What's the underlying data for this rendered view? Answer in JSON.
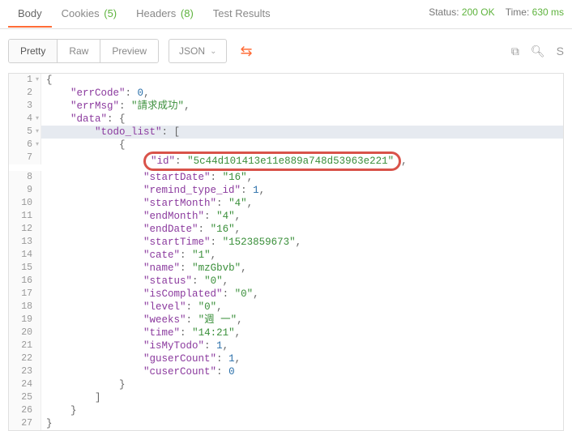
{
  "tabs": {
    "body": "Body",
    "cookies": "Cookies",
    "cookies_count": "(5)",
    "headers": "Headers",
    "headers_count": "(8)",
    "tests": "Test Results"
  },
  "status": {
    "status_label": "Status:",
    "status_value": "200 OK",
    "time_label": "Time:",
    "time_value": "630 ms"
  },
  "toolbar": {
    "pretty": "Pretty",
    "raw": "Raw",
    "preview": "Preview",
    "format": "JSON"
  },
  "json": {
    "errCode_key": "\"errCode\"",
    "errCode_val": "0",
    "errMsg_key": "\"errMsg\"",
    "errMsg_val": "\"請求成功\"",
    "data_key": "\"data\"",
    "todo_list_key": "\"todo_list\"",
    "id_key": "\"id\"",
    "id_val": "\"5c44d101413e11e889a748d53963e221\"",
    "startDate_key": "\"startDate\"",
    "startDate_val": "\"16\"",
    "remind_key": "\"remind_type_id\"",
    "remind_val": "1",
    "startMonth_key": "\"startMonth\"",
    "startMonth_val": "\"4\"",
    "endMonth_key": "\"endMonth\"",
    "endMonth_val": "\"4\"",
    "endDate_key": "\"endDate\"",
    "endDate_val": "\"16\"",
    "startTime_key": "\"startTime\"",
    "startTime_val": "\"1523859673\"",
    "cate_key": "\"cate\"",
    "cate_val": "\"1\"",
    "name_key": "\"name\"",
    "name_val": "\"mzGbvb\"",
    "status_key": "\"status\"",
    "status_val": "\"0\"",
    "isCompleted_key": "\"isComplated\"",
    "isCompleted_val": "\"0\"",
    "level_key": "\"level\"",
    "level_val": "\"0\"",
    "weeks_key": "\"weeks\"",
    "weeks_val": "\"週 一\"",
    "time_key": "\"time\"",
    "time_val": "\"14:21\"",
    "isMyTodo_key": "\"isMyTodo\"",
    "isMyTodo_val": "1",
    "guserCount_key": "\"guserCount\"",
    "guserCount_val": "1",
    "cuserCount_key": "\"cuserCount\"",
    "cuserCount_val": "0"
  }
}
